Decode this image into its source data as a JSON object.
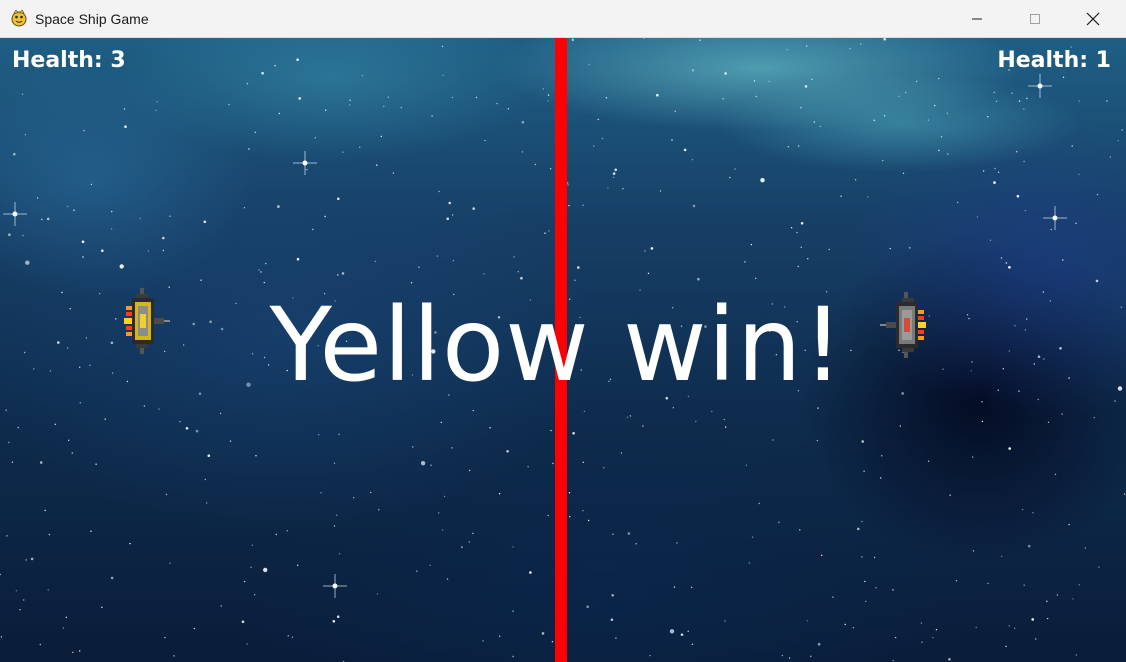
{
  "window": {
    "title": "Space Ship Game",
    "icon": "pygame-snake-icon",
    "controls": [
      "minimize-icon",
      "maximize-icon",
      "close-icon"
    ]
  },
  "game": {
    "divider_color": "#ff0000",
    "yellow_health_text": "Health: 3",
    "red_health_text": "Health: 1",
    "winner_text": "Yellow win!",
    "ships": {
      "yellow": {
        "color": "#f2d12e",
        "icon": "yellow-spaceship-icon"
      },
      "red": {
        "color": "#d64a3a",
        "icon": "red-spaceship-icon"
      }
    }
  }
}
